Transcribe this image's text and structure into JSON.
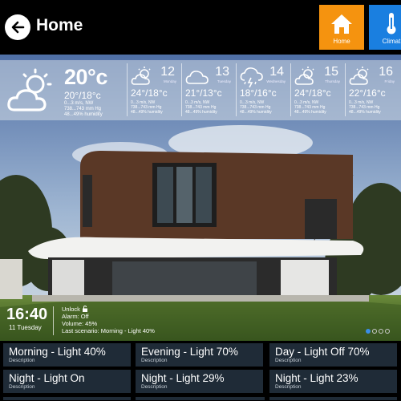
{
  "header": {
    "title": "Home",
    "nav": [
      {
        "label": "Home",
        "icon": "house-icon",
        "color": "#f5930f"
      },
      {
        "label": "Climat",
        "icon": "thermometer-icon",
        "color": "#1a7fe0"
      }
    ]
  },
  "weather": {
    "today": {
      "temp": "20°c",
      "range": "20°/18°c",
      "wind": "0...3  m/s, NW",
      "pressure": "738...743  mm Hg",
      "humidity": "48...49%  humidity",
      "icon": "partly-cloudy-icon"
    },
    "days": [
      {
        "num": "12",
        "weekday": "Monday",
        "temp": "24°/18°c",
        "wind": "0...3  m/s, NW",
        "pressure": "738...743  mm Hg",
        "humidity": "48...49%  humidity",
        "icon": "partly-cloudy-icon"
      },
      {
        "num": "13",
        "weekday": "Tuesday",
        "temp": "21°/13°c",
        "wind": "0...3  m/s, NW",
        "pressure": "738...743  mm Hg",
        "humidity": "48...49%  humidity",
        "icon": "cloud-icon"
      },
      {
        "num": "14",
        "weekday": "Wednesday",
        "temp": "18°/16°c",
        "wind": "0...3  m/s, NW",
        "pressure": "738...743  mm Hg",
        "humidity": "48...49%  humidity",
        "icon": "thunderstorm-icon"
      },
      {
        "num": "15",
        "weekday": "Thursday",
        "temp": "24°/18°c",
        "wind": "0...3  m/s, NW",
        "pressure": "738...743  mm Hg",
        "humidity": "48...49%  humidity",
        "icon": "partly-cloudy-icon"
      },
      {
        "num": "16",
        "weekday": "Friday",
        "temp": "22°/16°c",
        "wind": "0...3  m/s, NW",
        "pressure": "738...743  mm Hg",
        "humidity": "48...49%  humidity",
        "icon": "partly-cloudy-icon"
      }
    ]
  },
  "status": {
    "time": "16:40",
    "date": "11 Tuesday",
    "unlock": "Unlock",
    "alarm": "Alarm: Off",
    "volume": "Volume: 45%",
    "last_scenario": "Last scenario: Morning - Light 40%"
  },
  "carousel": {
    "pages": 4,
    "active": 0
  },
  "scenarios": [
    {
      "title": "Morning - Light 40%",
      "desc": "Description"
    },
    {
      "title": "Evening - Light 70%",
      "desc": "Description"
    },
    {
      "title": "Day - Light Off 70%",
      "desc": "Description"
    },
    {
      "title": "Night - Light On",
      "desc": "Description"
    },
    {
      "title": "Night - Light 29%",
      "desc": "Description"
    },
    {
      "title": "Night - Light 23%",
      "desc": "Description"
    }
  ]
}
